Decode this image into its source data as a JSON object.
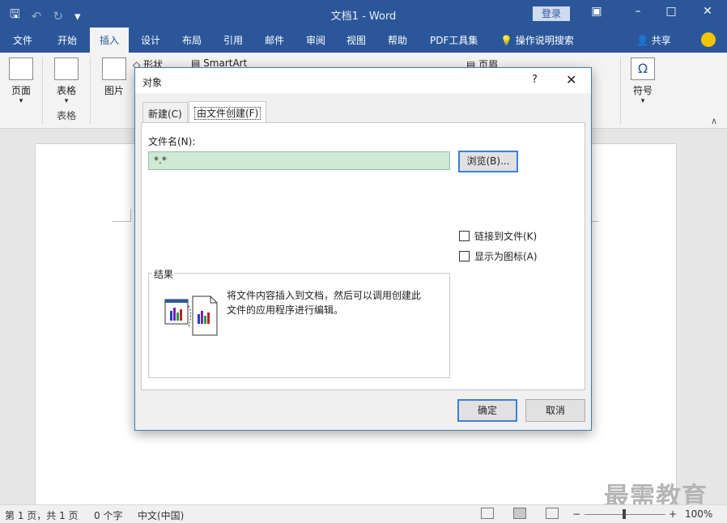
{
  "window": {
    "doc_title": "文档1 - Word",
    "login_label": "登录"
  },
  "ribbon_tabs": [
    "文件",
    "开始",
    "插入",
    "设计",
    "布局",
    "引用",
    "邮件",
    "审阅",
    "视图",
    "帮助",
    "PDF工具集"
  ],
  "active_tab": "插入",
  "tell_me": "操作说明搜索",
  "share": "共享",
  "ribbon": {
    "pages_label": "页面",
    "table_label": "表格",
    "table_group": "表格",
    "pictures_label": "图片",
    "shapes_label": "形状",
    "smartart_label": "SmartArt",
    "header_label": "页眉",
    "symbol_label": "符号",
    "symbol_glyph": "Ω"
  },
  "dialog": {
    "title": "对象",
    "help": "?",
    "close": "✕",
    "tabs": [
      "新建(C)",
      "由文件创建(F)"
    ],
    "file_name_label": "文件名(N):",
    "file_name_value": "*.*",
    "browse_label": "浏览(B)...",
    "link_to_file": "链接到文件(K)",
    "display_as_icon": "显示为图标(A)",
    "result_label": "结果",
    "result_text": "将文件内容插入到文档，然后可以调用创建此文件的应用程序进行编辑。",
    "ok_label": "确定",
    "cancel_label": "取消"
  },
  "status": {
    "page": "第 1 页，共 1 页",
    "words": "0 个字",
    "language": "中文(中国)",
    "zoom": "100%",
    "zoom_minus": "−",
    "zoom_plus": "+"
  },
  "watermark": "最需教育"
}
